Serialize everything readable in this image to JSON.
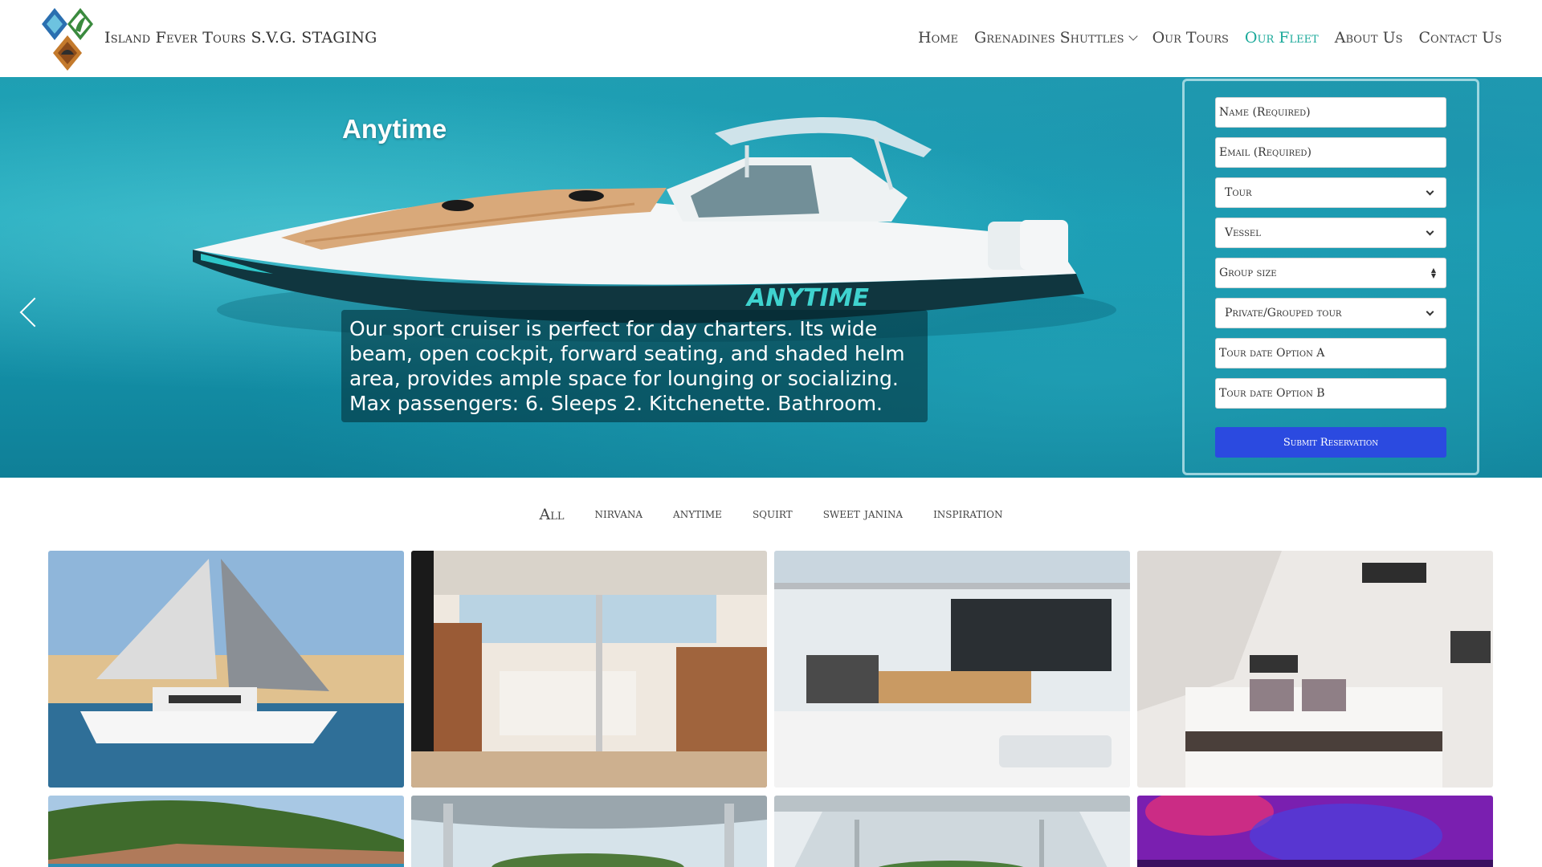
{
  "header": {
    "brand": "Island Fever Tours S.V.G. STAGING",
    "logo_icon": "diamond-logo-icon",
    "nav": [
      {
        "label": "Home",
        "active": false
      },
      {
        "label": "Grenadines Shuttles",
        "active": false,
        "has_dropdown": true
      },
      {
        "label": "Our Tours",
        "active": false
      },
      {
        "label": "Our Fleet",
        "active": true
      },
      {
        "label": "About Us",
        "active": false
      },
      {
        "label": "Contact Us",
        "active": false
      }
    ],
    "active_color": "#1aa99a"
  },
  "hero": {
    "title": "Anytime",
    "description_line1": "Our sport cruiser is perfect for day charters. Its wide beam, open cockpit, forward seating, and shaded helm area, provides ample space for lounging or socializing.",
    "description_line2": "Max passengers: 6. Sleeps 2. Kitchenette. Bathroom.",
    "hull_lettering": "ANYTIME",
    "prev_icon": "chevron-left-icon",
    "next_icon": "chevron-right-icon"
  },
  "form": {
    "name_placeholder": "Name (Required)",
    "email_placeholder": "Email (Required)",
    "tour_label": "Tour",
    "vessel_label": "Vessel",
    "group_size_placeholder": "Group size",
    "tour_type_label": "Private/Grouped tour",
    "date_a_placeholder": "Tour date Option A",
    "date_b_placeholder": "Tour date Option B",
    "submit_label": "Submit Reservation",
    "submit_color": "#2b4ae0"
  },
  "filters": [
    "All",
    "nirvana",
    "anytime",
    "squirt",
    "sweet janina",
    "inspiration"
  ],
  "gallery": [
    {
      "subject": "catamaran-sailing"
    },
    {
      "subject": "galley-interior"
    },
    {
      "subject": "cockpit-deck"
    },
    {
      "subject": "cabin-bedroom"
    },
    {
      "subject": "coastline-cliffs"
    },
    {
      "subject": "bimini-view"
    },
    {
      "subject": "flybridge-view"
    },
    {
      "subject": "neon-lounge"
    }
  ]
}
